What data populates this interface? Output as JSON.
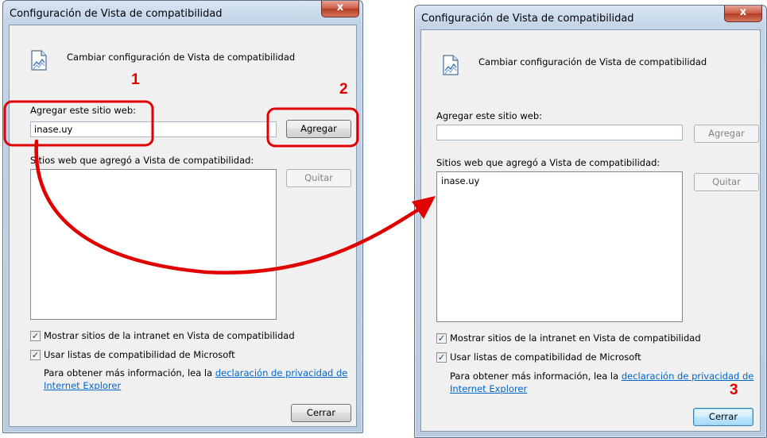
{
  "dialog_left": {
    "title": "Configuración de Vista de compatibilidad",
    "close_glyph": "x",
    "header_icon": "compatibility-view-icon",
    "header_text": "Cambiar configuración de Vista de compatibilidad",
    "add_label": "Agregar este sitio web:",
    "add_value": "inase.uy",
    "add_button": "Agregar",
    "list_label": "Sitios web que agregó a Vista de compatibilidad:",
    "list_items": [],
    "remove_button": "Quitar",
    "checkbox_intranet": {
      "label": "Mostrar sitios de la intranet en Vista de compatibilidad",
      "checked": true
    },
    "checkbox_microsoft": {
      "label": "Usar listas de compatibilidad de Microsoft",
      "checked": true
    },
    "info_text": "Para obtener más información, lea la ",
    "info_link_1": "declaración de privacidad de",
    "info_link_2": "Internet Explorer",
    "close_button": "Cerrar"
  },
  "dialog_right": {
    "title": "Configuración de Vista de compatibilidad",
    "close_glyph": "x",
    "header_icon": "compatibility-view-icon",
    "header_text": "Cambiar configuración de Vista de compatibilidad",
    "add_label": "Agregar este sitio web:",
    "add_value": "",
    "add_button": "Agregar",
    "list_label": "Sitios web que agregó a Vista de compatibilidad:",
    "list_items": [
      "inase.uy"
    ],
    "remove_button": "Quitar",
    "checkbox_intranet": {
      "label": "Mostrar sitios de la intranet en Vista de compatibilidad",
      "checked": true
    },
    "checkbox_microsoft": {
      "label": "Usar listas de compatibilidad de Microsoft",
      "checked": true
    },
    "info_text": "Para obtener más información, lea la ",
    "info_link_1": "declaración de privacidad de",
    "info_link_2": "Internet Explorer",
    "close_button": "Cerrar"
  },
  "annotations": {
    "step_1": "1",
    "step_2": "2",
    "step_3": "3",
    "color": "#e00000"
  }
}
